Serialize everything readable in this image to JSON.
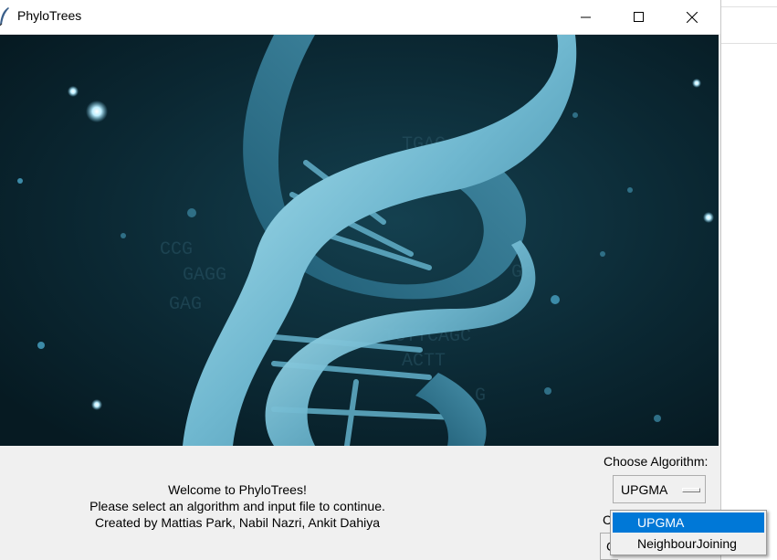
{
  "window": {
    "title": "PhyloTrees",
    "controls": [
      "minimize",
      "maximize",
      "close"
    ]
  },
  "banner": {
    "icon": "dna-helix-image",
    "background_color": "#0b2530",
    "helix_color": "#8fd3e8"
  },
  "welcome": {
    "line1": "Welcome to PhyloTrees!",
    "line2": "Please select an algorithm and input file to continue.",
    "line3": "Created by Mattias Park, Nabil Nazri, Ankit Dahiya"
  },
  "algorithm": {
    "label": "Choose Algorithm:",
    "selected": "UPGMA",
    "options": [
      "UPGMA",
      "NeighbourJoining"
    ],
    "highlight_color": "#0078d7"
  },
  "obscured": {
    "label_fragment": "C",
    "button_fragment": "C"
  }
}
